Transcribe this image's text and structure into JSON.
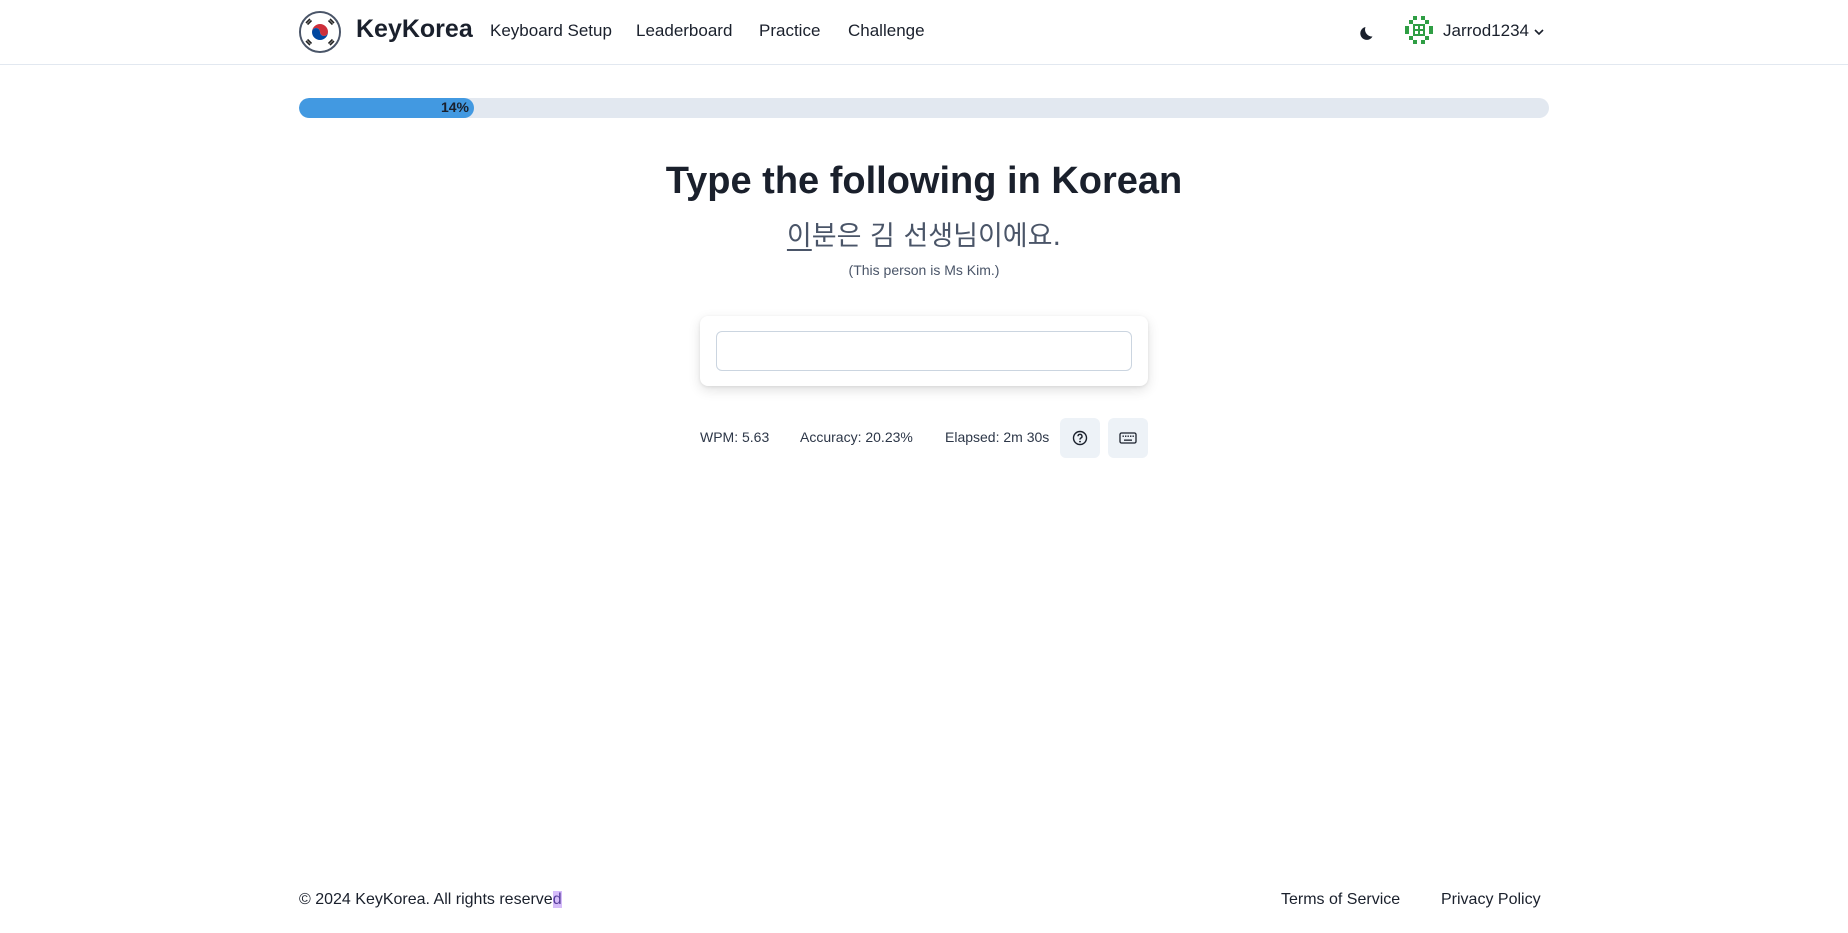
{
  "header": {
    "brand": "KeyKorea",
    "logo_icon": "korea-flag-icon",
    "nav": [
      {
        "label": "Keyboard Setup"
      },
      {
        "label": "Leaderboard"
      },
      {
        "label": "Practice"
      },
      {
        "label": "Challenge"
      }
    ],
    "theme_icon": "moon-icon",
    "user": {
      "name": "Jarrod1234",
      "avatar_icon": "identicon-avatar",
      "caret_icon": "chevron-down-icon"
    }
  },
  "progress": {
    "value_percent": 14,
    "label": "14%"
  },
  "exercise": {
    "heading": "Type the following in Korean",
    "korean_current": "이",
    "korean_rest": "분은 김 선생님이에요.",
    "translation": "(This person is Ms Kim.)",
    "input_value": "",
    "input_placeholder": ""
  },
  "stats": {
    "wpm": "WPM: 5.63",
    "accuracy": "Accuracy: 20.23%",
    "elapsed": "Elapsed: 2m 30s",
    "help_icon": "question-circle-icon",
    "keyboard_icon": "keyboard-icon"
  },
  "footer": {
    "copyright_main": "© 2024 KeyKorea. All rights reserve",
    "copyright_selected": "d",
    "links": [
      {
        "label": "Terms of Service"
      },
      {
        "label": "Privacy Policy"
      }
    ]
  },
  "colors": {
    "accent": "#4299e1",
    "text": "#1a202c",
    "muted": "#4a5568",
    "progress_track": "#e2e8f0",
    "selection": "#d6bcfa"
  }
}
